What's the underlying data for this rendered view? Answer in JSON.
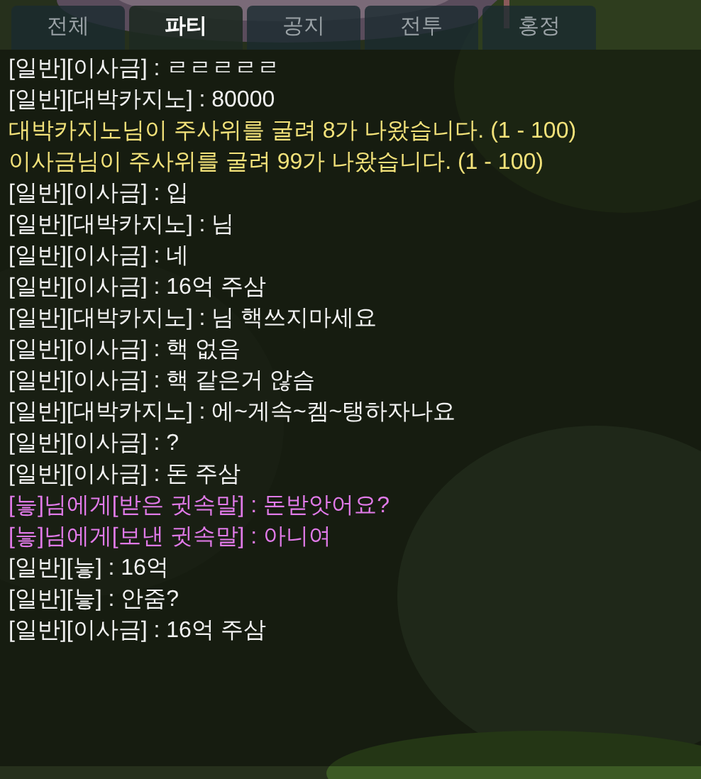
{
  "tabs": [
    {
      "label": "전체",
      "selected": false
    },
    {
      "label": "파티",
      "selected": true
    },
    {
      "label": "공지",
      "selected": false
    },
    {
      "label": "전투",
      "selected": false
    },
    {
      "label": "홍정",
      "selected": false
    }
  ],
  "messages": [
    {
      "kind": "normal",
      "text": "[일반][이사금] : ㄹㄹㄹㄹㄹ"
    },
    {
      "kind": "normal",
      "text": "[일반][대박카지노] : 80000"
    },
    {
      "kind": "dice",
      "text": "대박카지노님이 주사위를 굴려 8가 나왔습니다. (1 - 100)"
    },
    {
      "kind": "dice",
      "text": "이사금님이 주사위를 굴려 99가 나왔습니다. (1 - 100)"
    },
    {
      "kind": "normal",
      "text": "[일반][이사금] : 입"
    },
    {
      "kind": "normal",
      "text": "[일반][대박카지노] : 님"
    },
    {
      "kind": "normal",
      "text": "[일반][이사금] : 네"
    },
    {
      "kind": "normal",
      "text": "[일반][이사금] : 16억 주삼"
    },
    {
      "kind": "normal",
      "text": "[일반][대박카지노] : 님 핵쓰지마세요"
    },
    {
      "kind": "normal",
      "text": "[일반][이사금] : 핵 없음"
    },
    {
      "kind": "normal",
      "text": "[일반][이사금] : 핵 같은거 않슴"
    },
    {
      "kind": "normal",
      "text": "[일반][대박카지노] : 에~게속~켐~탱하자나요"
    },
    {
      "kind": "normal",
      "text": "[일반][이사금] : ?"
    },
    {
      "kind": "normal",
      "text": "[일반][이사금] : 돈 주삼"
    },
    {
      "kind": "whisper",
      "text": "[늫]님에게[받은 귓속말] : 돈받앗어요?"
    },
    {
      "kind": "whisper",
      "text": "[늫]님에게[보낸 귓속말] : 아니여"
    },
    {
      "kind": "normal",
      "text": "[일반][늫] : 16억"
    },
    {
      "kind": "normal",
      "text": "[일반][늫] : 안줌?"
    },
    {
      "kind": "normal",
      "text": "[일반][이사금] : 16억 주삼"
    }
  ]
}
